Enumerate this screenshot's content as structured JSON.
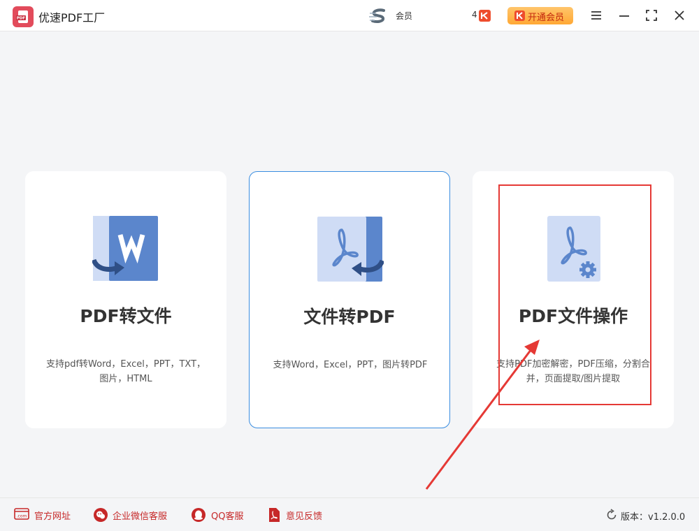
{
  "app": {
    "title": "优速PDF工厂",
    "logo_text": "PDF"
  },
  "header": {
    "member_label": "会员",
    "coin_count": "4",
    "vip_button_label": "开通会员"
  },
  "cards": [
    {
      "title": "PDF转文件",
      "desc_line1": "支持pdf转Word，Excel，PPT，TXT，",
      "desc_line2": "图片，HTML"
    },
    {
      "title": "文件转PDF",
      "desc_line1": "支持Word，Excel，PPT，图片转PDF",
      "desc_line2": ""
    },
    {
      "title": "PDF文件操作",
      "desc_line1": "支持PDF加密解密，PDF压缩，分割合",
      "desc_line2": "并，页面提取/图片提取"
    }
  ],
  "footer": {
    "links": [
      {
        "label": "官方网址",
        "icon": "website-icon"
      },
      {
        "label": "企业微信客服",
        "icon": "wechat-service-icon"
      },
      {
        "label": "QQ客服",
        "icon": "qq-icon"
      },
      {
        "label": "意见反馈",
        "icon": "feedback-icon"
      }
    ],
    "version": "版本：v1.2.0.0"
  },
  "colors": {
    "accent": "#3a8de0",
    "brand": "#e24b5b",
    "vip": "#ffa834",
    "annotation": "#e53935",
    "icon_blue": "#5b86cc",
    "icon_light": "#cfdcf5"
  }
}
